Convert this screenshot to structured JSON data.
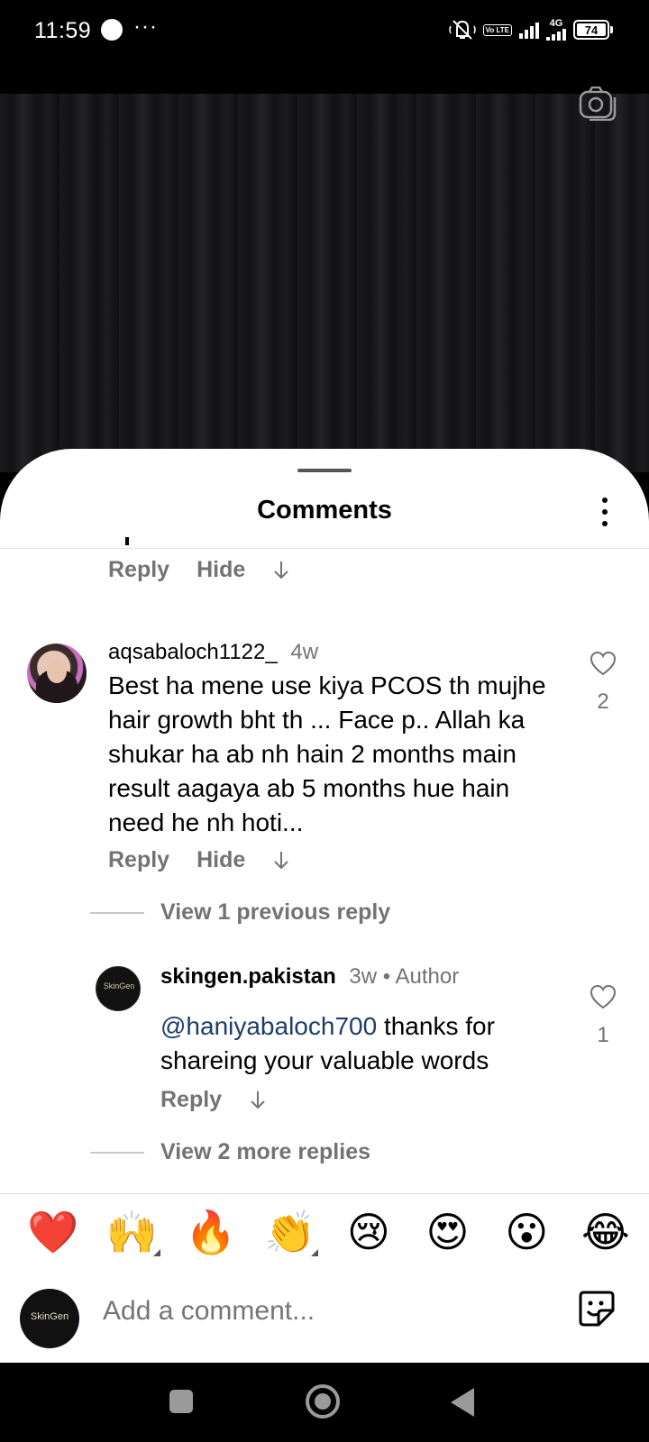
{
  "status_bar": {
    "time": "11:59",
    "more": "···",
    "network": "4G",
    "volte": "Vo LTE",
    "battery": "74"
  },
  "sheet": {
    "title": "Comments"
  },
  "comments": [
    {
      "actions": {
        "reply": "Reply",
        "hide": "Hide"
      }
    },
    {
      "username": "aqsabaloch1122_",
      "time": "4w",
      "text": "Best ha mene use kiya PCOS th mujhe hair growth bht th ... Face p.. Allah ka shukar ha ab nh hain 2 months main result aagaya ab 5 months hue hain need he nh hoti...",
      "likes": "2",
      "actions": {
        "reply": "Reply",
        "hide": "Hide"
      },
      "view_previous": "View 1 previous reply",
      "reply": {
        "username": "skingen.pakistan",
        "time": "3w",
        "badge": "Author",
        "avatar_text": "SkinGen",
        "mention": "@haniyabaloch700",
        "text": " thanks for shareing your valuable words",
        "likes": "1",
        "reply_label": "Reply"
      },
      "view_more": "View 2 more replies"
    }
  ],
  "emoji_bar": [
    "❤️",
    "🙌",
    "🔥",
    "👏",
    "😢",
    "😍",
    "😮",
    "😂"
  ],
  "composer": {
    "avatar_text": "SkinGen",
    "placeholder": "Add a comment..."
  }
}
